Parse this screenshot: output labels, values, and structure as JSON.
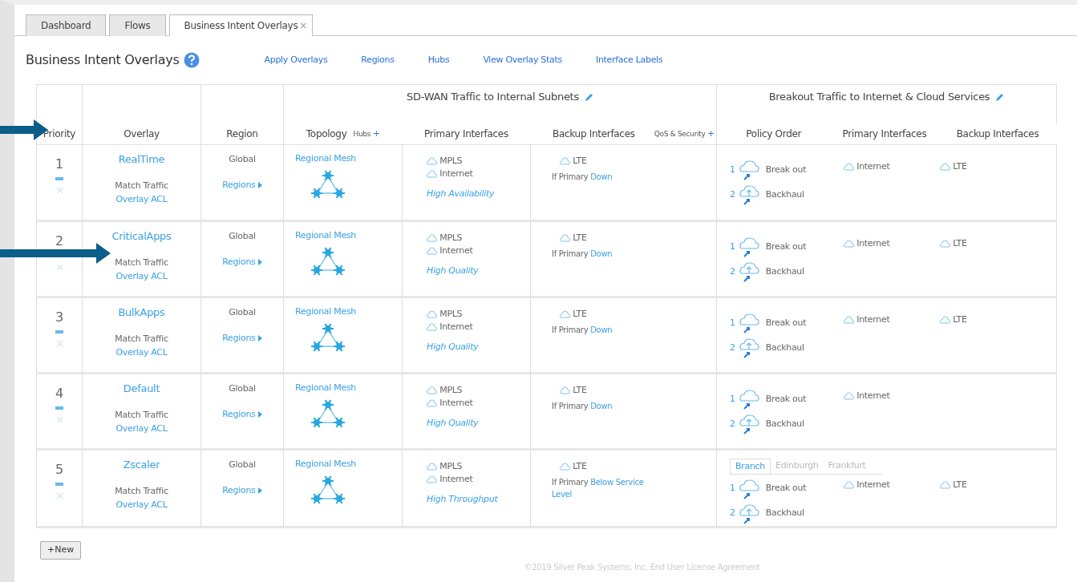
{
  "tabs": [
    {
      "label": "Dashboard",
      "selected": false
    },
    {
      "label": "Flows",
      "selected": false
    },
    {
      "label": "Business Intent Overlays",
      "selected": true,
      "close": "×"
    }
  ],
  "page": {
    "title": "Business Intent Overlays",
    "links": [
      "Apply Overlays",
      "Regions",
      "Hubs",
      "View Overlay Stats",
      "Interface Labels"
    ]
  },
  "table": {
    "groups": [
      {
        "title": "SD-WAN Traffic to Internal Subnets"
      },
      {
        "title": "Breakout Traffic to Internet & Cloud Services"
      }
    ],
    "columns": [
      "Priority",
      "Overlay",
      "Region",
      "Topology",
      "Primary Interfaces",
      "Backup Interfaces",
      "Policy Order",
      "Primary Interfaces",
      "Backup Interfaces"
    ],
    "hubs_label": "Hubs",
    "hubs_add": "+",
    "qos_label": "QoS & Security",
    "qos_add": "+",
    "rows": [
      {
        "priority": "1",
        "name": "RealTime",
        "match": "Match Traffic",
        "acl": "Overlay ACL",
        "region": "Global",
        "regions_link": "Regions",
        "topology": "Regional Mesh",
        "primary": [
          "MPLS",
          "Internet"
        ],
        "policy": "High Availability",
        "backup": [
          "LTE"
        ],
        "condition_prefix": "If Primary",
        "condition": "Down",
        "breakout": {
          "policies": [
            {
              "order": "1",
              "label": "Break out",
              "kind": "breakout"
            },
            {
              "order": "2",
              "label": "Backhaul",
              "kind": "backhaul"
            }
          ],
          "primary": [
            "Internet"
          ],
          "backup": [
            "LTE"
          ]
        }
      },
      {
        "priority": "2",
        "name": "CriticalApps",
        "match": "Match Traffic",
        "acl": "Overlay ACL",
        "region": "Global",
        "regions_link": "Regions",
        "topology": "Regional Mesh",
        "primary": [
          "MPLS",
          "Internet"
        ],
        "policy": "High Quality",
        "backup": [
          "LTE"
        ],
        "condition_prefix": "If Primary",
        "condition": "Down",
        "breakout": {
          "policies": [
            {
              "order": "1",
              "label": "Break out",
              "kind": "breakout"
            },
            {
              "order": "2",
              "label": "Backhaul",
              "kind": "backhaul"
            }
          ],
          "primary": [
            "Internet"
          ],
          "backup": [
            "LTE"
          ]
        }
      },
      {
        "priority": "3",
        "name": "BulkApps",
        "match": "Match Traffic",
        "acl": "Overlay ACL",
        "region": "Global",
        "regions_link": "Regions",
        "topology": "Regional Mesh",
        "primary": [
          "MPLS",
          "Internet"
        ],
        "policy": "High Quality",
        "backup": [
          "LTE"
        ],
        "condition_prefix": "If Primary",
        "condition": "Down",
        "breakout": {
          "policies": [
            {
              "order": "1",
              "label": "Break out",
              "kind": "breakout"
            },
            {
              "order": "2",
              "label": "Backhaul",
              "kind": "backhaul"
            }
          ],
          "primary": [
            "Internet"
          ],
          "backup": [
            "LTE"
          ]
        }
      },
      {
        "priority": "4",
        "name": "Default",
        "match": "Match Traffic",
        "acl": "Overlay ACL",
        "region": "Global",
        "regions_link": "Regions",
        "topology": "Regional Mesh",
        "primary": [
          "MPLS",
          "Internet"
        ],
        "policy": "High Quality",
        "backup": [
          "LTE"
        ],
        "condition_prefix": "If Primary",
        "condition": "Down",
        "breakout": {
          "policies": [
            {
              "order": "1",
              "label": "Break out",
              "kind": "breakout"
            },
            {
              "order": "2",
              "label": "Backhaul",
              "kind": "backhaul"
            }
          ],
          "primary": [
            "Internet"
          ]
        }
      },
      {
        "priority": "5",
        "name": "Zscaler",
        "match": "Match Traffic",
        "acl": "Overlay ACL",
        "region": "Global",
        "regions_link": "Regions",
        "topology": "Regional Mesh",
        "primary": [
          "MPLS",
          "Internet"
        ],
        "policy": "High Throughput",
        "backup": [
          "LTE"
        ],
        "condition_prefix": "If Primary",
        "condition": "Below Service Level",
        "breakout": {
          "region_tabs": [
            {
              "label": "Branch",
              "selected": true
            },
            {
              "label": "Edinburgh",
              "selected": false
            },
            {
              "label": "Frankfurt",
              "selected": false
            }
          ],
          "policies": [
            {
              "order": "1",
              "label": "Break out",
              "kind": "breakout"
            },
            {
              "order": "2",
              "label": "Backhaul",
              "kind": "backhaul"
            }
          ],
          "primary": [
            "Internet"
          ],
          "backup": [
            "LTE"
          ]
        }
      }
    ]
  },
  "new_button": "+New",
  "footer": "©2019 Silver Peak Systems, Inc. End User License Agreement"
}
